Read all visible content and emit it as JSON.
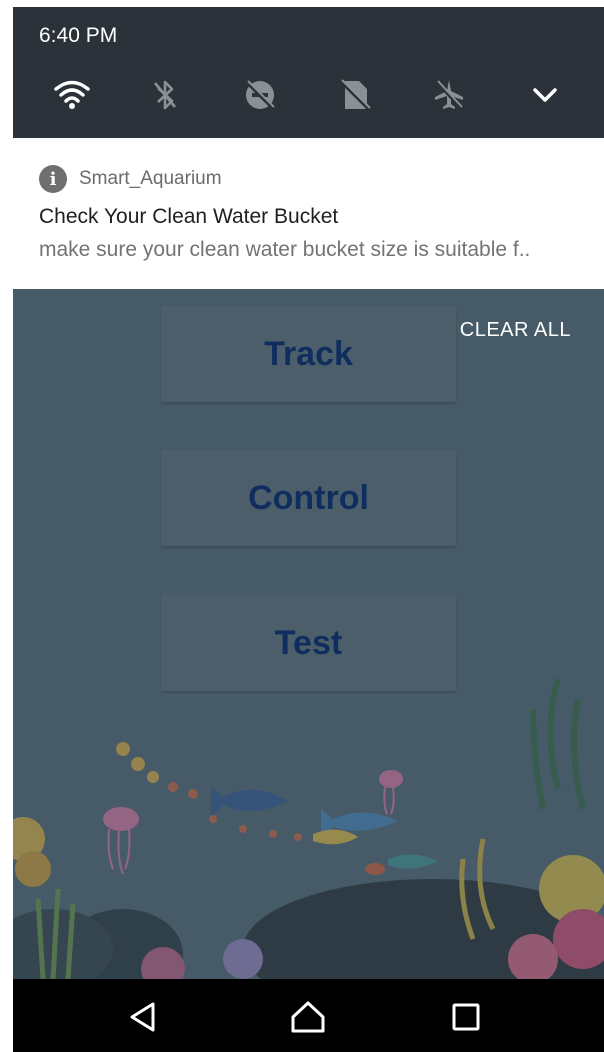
{
  "status": {
    "time": "6:40 PM"
  },
  "quick_settings": {
    "icons": [
      "wifi-icon",
      "bluetooth-off-icon",
      "do-not-disturb-off-icon",
      "sim-off-icon",
      "airplane-mode-off-icon",
      "chevron-down-icon"
    ]
  },
  "notification": {
    "app_name": "Smart_Aquarium",
    "title": "Check Your Clean Water Bucket",
    "text": "make sure your clean water bucket size is suitable f.."
  },
  "app": {
    "clear_all": "CLEAR ALL",
    "buttons": {
      "track": "Track",
      "control": "Control",
      "test": "Test"
    }
  },
  "nav": {
    "icons": [
      "back-icon",
      "home-icon",
      "recents-icon"
    ]
  },
  "colors": {
    "quick_settings_bg": "#2c3239",
    "app_scrim": "#465b67",
    "button_text": "#0f2d5f",
    "navbar_bg": "#000000"
  }
}
